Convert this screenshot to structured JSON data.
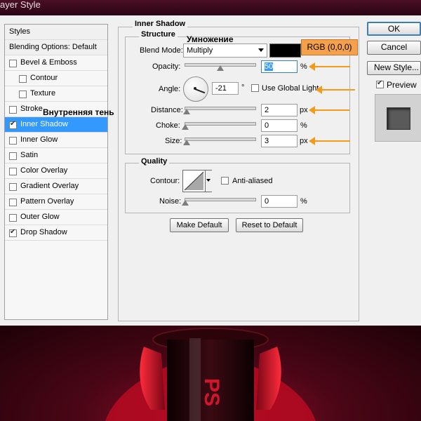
{
  "window": {
    "title": "ayer Style"
  },
  "styles_list": {
    "header": "Styles",
    "blending_options": "Blending Options: Default",
    "items": [
      {
        "label": "Bevel & Emboss",
        "checked": false,
        "indent": false,
        "selected": false
      },
      {
        "label": "Contour",
        "checked": false,
        "indent": true,
        "selected": false
      },
      {
        "label": "Texture",
        "checked": false,
        "indent": true,
        "selected": false
      },
      {
        "label": "Stroke",
        "checked": false,
        "indent": false,
        "selected": false
      },
      {
        "label": "Inner Shadow",
        "checked": true,
        "indent": false,
        "selected": true
      },
      {
        "label": "Inner Glow",
        "checked": false,
        "indent": false,
        "selected": false
      },
      {
        "label": "Satin",
        "checked": false,
        "indent": false,
        "selected": false
      },
      {
        "label": "Color Overlay",
        "checked": false,
        "indent": false,
        "selected": false
      },
      {
        "label": "Gradient Overlay",
        "checked": false,
        "indent": false,
        "selected": false
      },
      {
        "label": "Pattern Overlay",
        "checked": false,
        "indent": false,
        "selected": false
      },
      {
        "label": "Outer Glow",
        "checked": false,
        "indent": false,
        "selected": false
      },
      {
        "label": "Drop Shadow",
        "checked": true,
        "indent": false,
        "selected": false
      }
    ]
  },
  "panel": {
    "title": "Inner Shadow",
    "structure": {
      "title": "Structure",
      "blend_mode_label": "Blend Mode:",
      "blend_mode_value": "Multiply",
      "shadow_color": "#000000",
      "opacity_label": "Opacity:",
      "opacity_value": "50",
      "opacity_fraction": 0.5,
      "pct": "%",
      "angle_label": "Angle:",
      "angle_value": "-21",
      "degree": "°",
      "use_global_light": "Use Global Light",
      "distance_label": "Distance:",
      "distance_value": "2",
      "distance_fraction": 0.02,
      "px": "px",
      "choke_label": "Choke:",
      "choke_value": "0",
      "choke_fraction": 0,
      "size_label": "Size:",
      "size_value": "3",
      "size_fraction": 0.02
    },
    "quality": {
      "title": "Quality",
      "contour_label": "Contour:",
      "anti_aliased": "Anti-aliased",
      "noise_label": "Noise:",
      "noise_value": "0",
      "noise_fraction": 0,
      "pct": "%"
    },
    "make_default": "Make Default",
    "reset_default": "Reset to Default"
  },
  "buttons": {
    "ok": "OK",
    "cancel": "Cancel",
    "new_style": "New Style...",
    "preview": "Preview"
  },
  "annotations": {
    "multiply_ru": "Умножение",
    "inner_shadow_ru": "Внутренняя тень",
    "rgb": "RGB (0,0,0)"
  },
  "colors": {
    "selection": "#3399ff",
    "accent_arrow": "#f39a18",
    "rgb_badge": "#f5a04a"
  }
}
